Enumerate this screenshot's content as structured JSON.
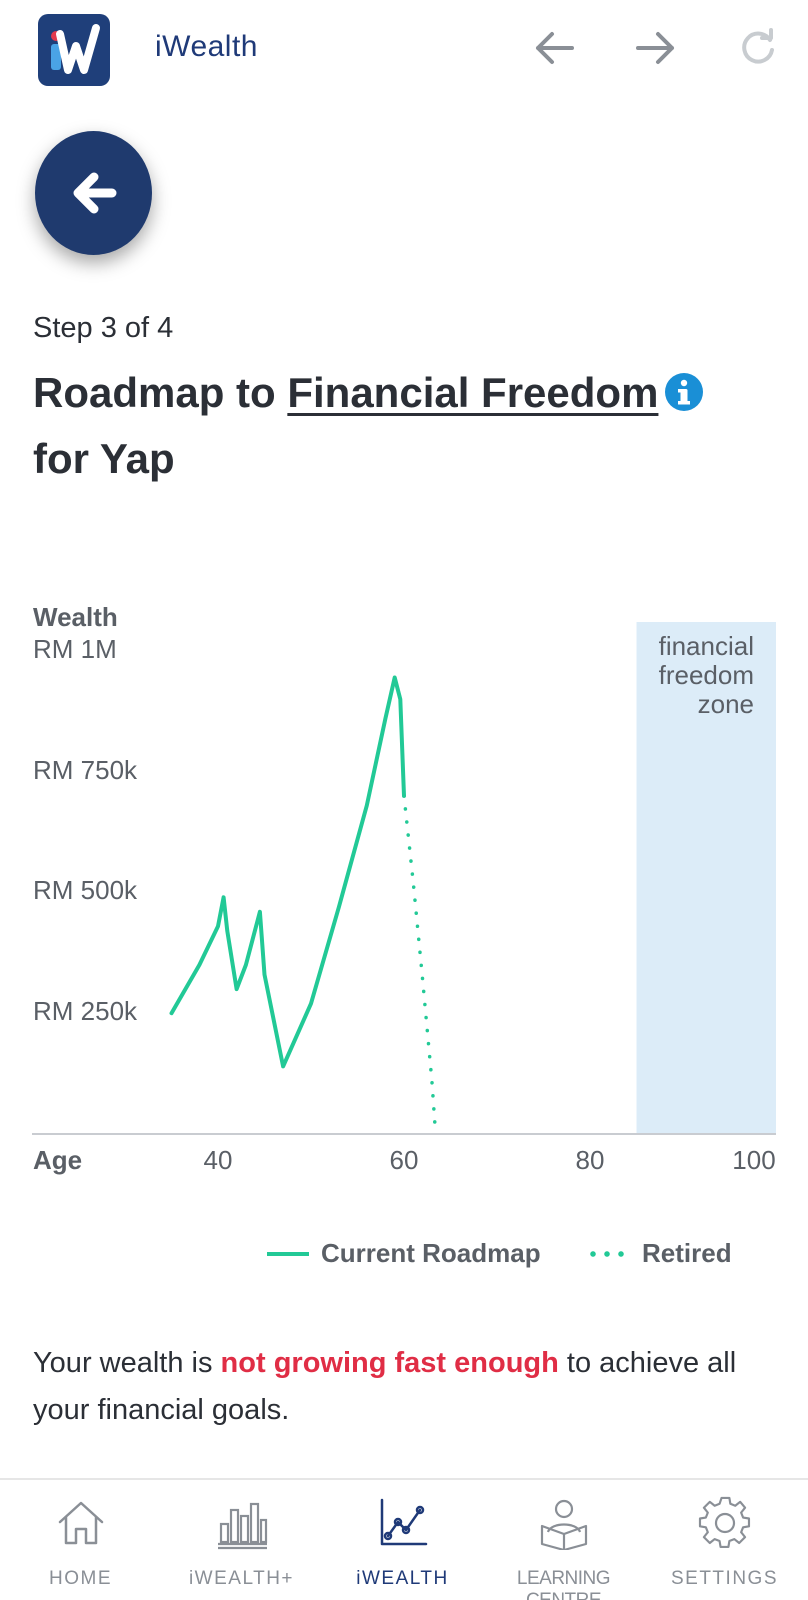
{
  "header": {
    "app_title": "iWealth",
    "logo_icon": "iwealth-logo",
    "nav": [
      "back-arrow-icon",
      "forward-arrow-icon",
      "refresh-icon"
    ]
  },
  "step_label": "Step 3 of 4",
  "heading": {
    "prefix": "Roadmap to ",
    "link": "Financial Freedom",
    "suffix": "for Yap"
  },
  "chart_data": {
    "type": "line",
    "ylabel": "Wealth",
    "xlabel": "Age",
    "y_tick_labels": [
      "RM 1M",
      "RM 750k",
      "RM 500k",
      "RM 250k"
    ],
    "y_tick_values": [
      1000000,
      750000,
      500000,
      250000
    ],
    "x_tick_labels": [
      "40",
      "60",
      "80",
      "100"
    ],
    "x_tick_values": [
      40,
      60,
      80,
      100
    ],
    "xlim": [
      20,
      100
    ],
    "ylim": [
      0,
      1060000
    ],
    "zone": {
      "label": "financial freedom zone",
      "x_range": [
        85,
        100
      ],
      "color": "#dcecf8"
    },
    "series": [
      {
        "name": "Current Roadmap",
        "style": "solid",
        "color": "#22c996",
        "x": [
          35,
          38,
          40,
          40.6,
          41,
          42,
          43,
          44.5,
          45,
          47,
          50,
          53,
          56,
          58,
          59,
          59.6,
          60
        ],
        "y": [
          250000,
          350000,
          430000,
          490000,
          420000,
          300000,
          350000,
          460000,
          330000,
          140000,
          270000,
          470000,
          680000,
          860000,
          945000,
          900000,
          700000
        ]
      },
      {
        "name": "Retired",
        "style": "dotted",
        "color": "#22c996",
        "x": [
          60,
          61,
          62,
          63,
          63.4
        ],
        "y": [
          700000,
          520000,
          320000,
          110000,
          0
        ]
      }
    ],
    "legend": [
      "Current Roadmap",
      "Retired"
    ],
    "grid": false
  },
  "message": {
    "prefix": "Your wealth is ",
    "highlight": "not growing fast enough",
    "suffix": " to achieve all your financial goals."
  },
  "bottom_nav": [
    {
      "label": "HOME",
      "icon": "home-icon",
      "active": false
    },
    {
      "label": "iWEALTH+",
      "icon": "bar-chart-icon",
      "active": false
    },
    {
      "label": "iWEALTH",
      "icon": "line-chart-icon",
      "active": true
    },
    {
      "label": "LEARNING CENTRE",
      "icon": "reader-icon",
      "active": false
    },
    {
      "label": "SETTINGS",
      "icon": "gear-icon",
      "active": false
    }
  ],
  "colors": {
    "brand_navy": "#1f3a78",
    "accent_green": "#22c996",
    "warning_red": "#e02d45",
    "info_blue": "#1a8fd6",
    "zone_blue": "#dcecf8"
  }
}
